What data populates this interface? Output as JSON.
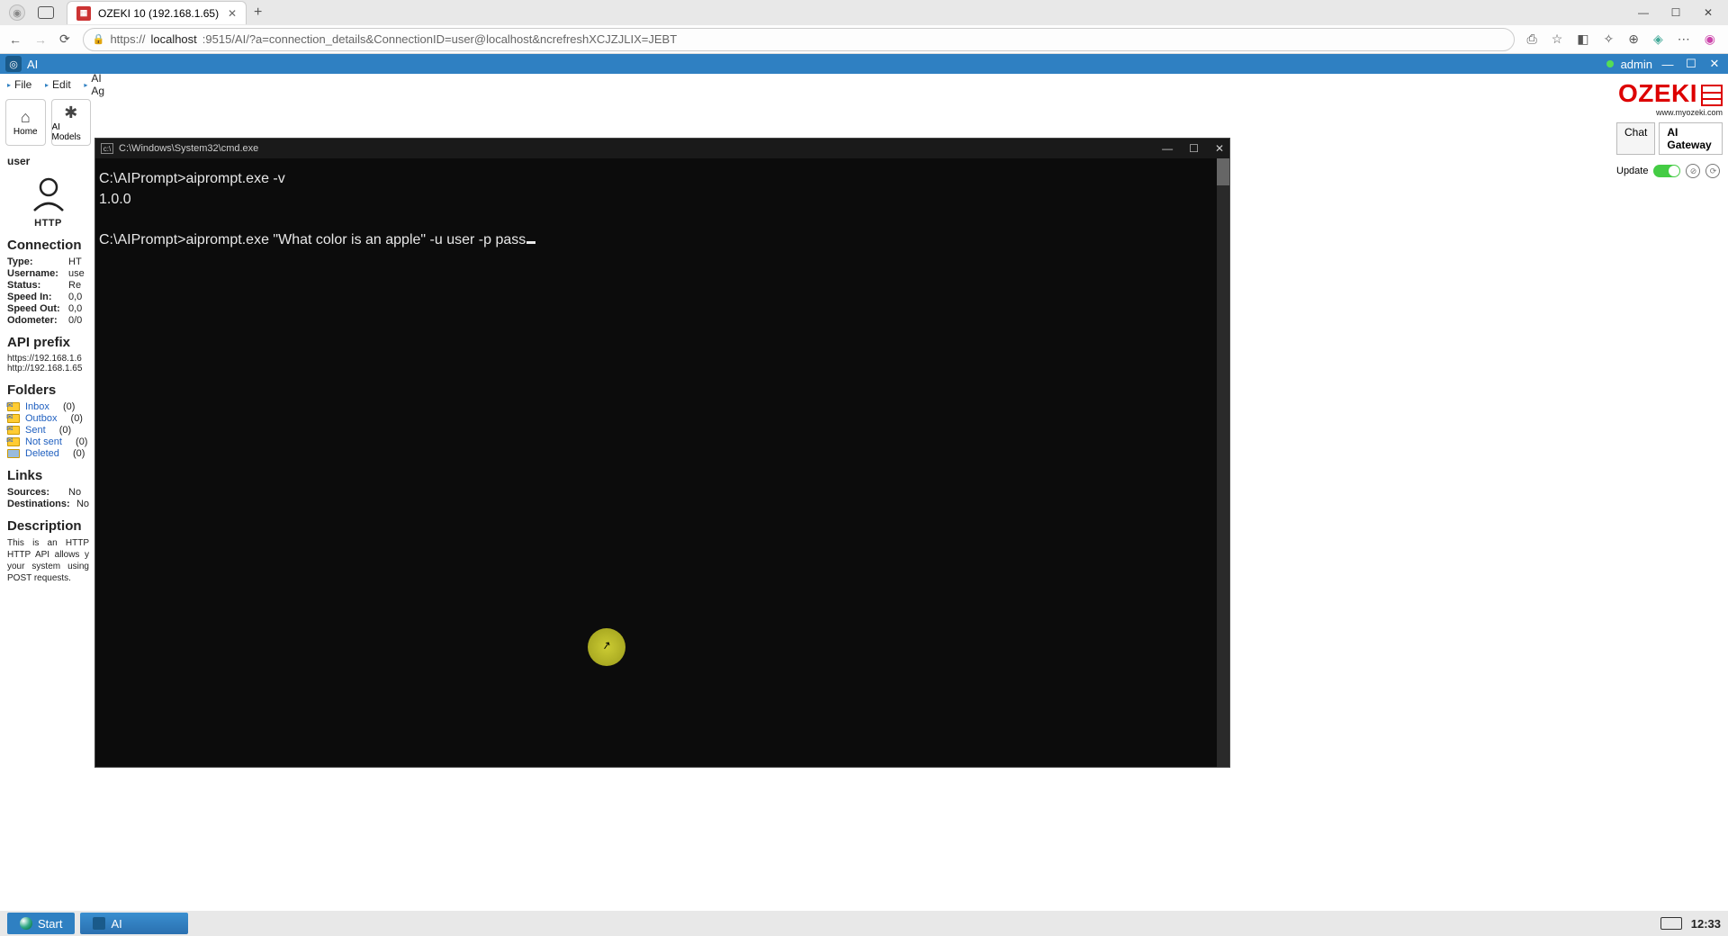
{
  "browser": {
    "tab_title": "OZEKI 10 (192.168.1.65)",
    "url_pre": "https://",
    "url_host": "localhost",
    "url_rest": ":9515/AI/?a=connection_details&ConnectionID=user@localhost&ncrefreshXCJZJLIX=JEBT"
  },
  "app": {
    "title": "AI",
    "admin": "admin",
    "menu_file": "File",
    "menu_edit": "Edit",
    "menu_aiag": "AI Ag",
    "tool_home": "Home",
    "tool_models": "AI Models"
  },
  "sidebar": {
    "user_heading": "user",
    "http_label": "HTTP",
    "section_connection": "Connection",
    "conn": {
      "type_k": "Type:",
      "type_v": "HT",
      "user_k": "Username:",
      "user_v": "use",
      "status_k": "Status:",
      "status_v": "Re",
      "sin_k": "Speed In:",
      "sin_v": "0,0",
      "sout_k": "Speed Out:",
      "sout_v": "0,0",
      "odo_k": "Odometer:",
      "odo_v": "0/0"
    },
    "section_api": "API prefix",
    "api1": "https://192.168.1.6",
    "api2": "http://192.168.1.65",
    "section_folders": "Folders",
    "folders": {
      "inbox": "Inbox",
      "inbox_c": "(0)",
      "outbox": "Outbox",
      "outbox_c": "(0)",
      "sent": "Sent",
      "sent_c": "(0)",
      "notsent": "Not sent",
      "notsent_c": "(0)",
      "deleted": "Deleted",
      "deleted_c": "(0)"
    },
    "section_links": "Links",
    "links": {
      "src_k": "Sources:",
      "src_v": "No",
      "dst_k": "Destinations:",
      "dst_v": "No"
    },
    "section_desc": "Description",
    "desc": "This is an HTTP HTTP API allows y your system using POST requests."
  },
  "right": {
    "brand": "OZEKI",
    "brand_sub": "www.myozeki.com",
    "tab_chat": "Chat",
    "tab_gateway": "AI Gateway",
    "update": "Update"
  },
  "cmd": {
    "title": "C:\\Windows\\System32\\cmd.exe",
    "line1": "C:\\AIPrompt>aiprompt.exe -v",
    "line2": "1.0.0",
    "line3": "",
    "line4": "C:\\AIPrompt>aiprompt.exe \"What color is an apple\" -u user -p pass"
  },
  "taskbar": {
    "start": "Start",
    "app": "AI",
    "clock": "12:33"
  }
}
